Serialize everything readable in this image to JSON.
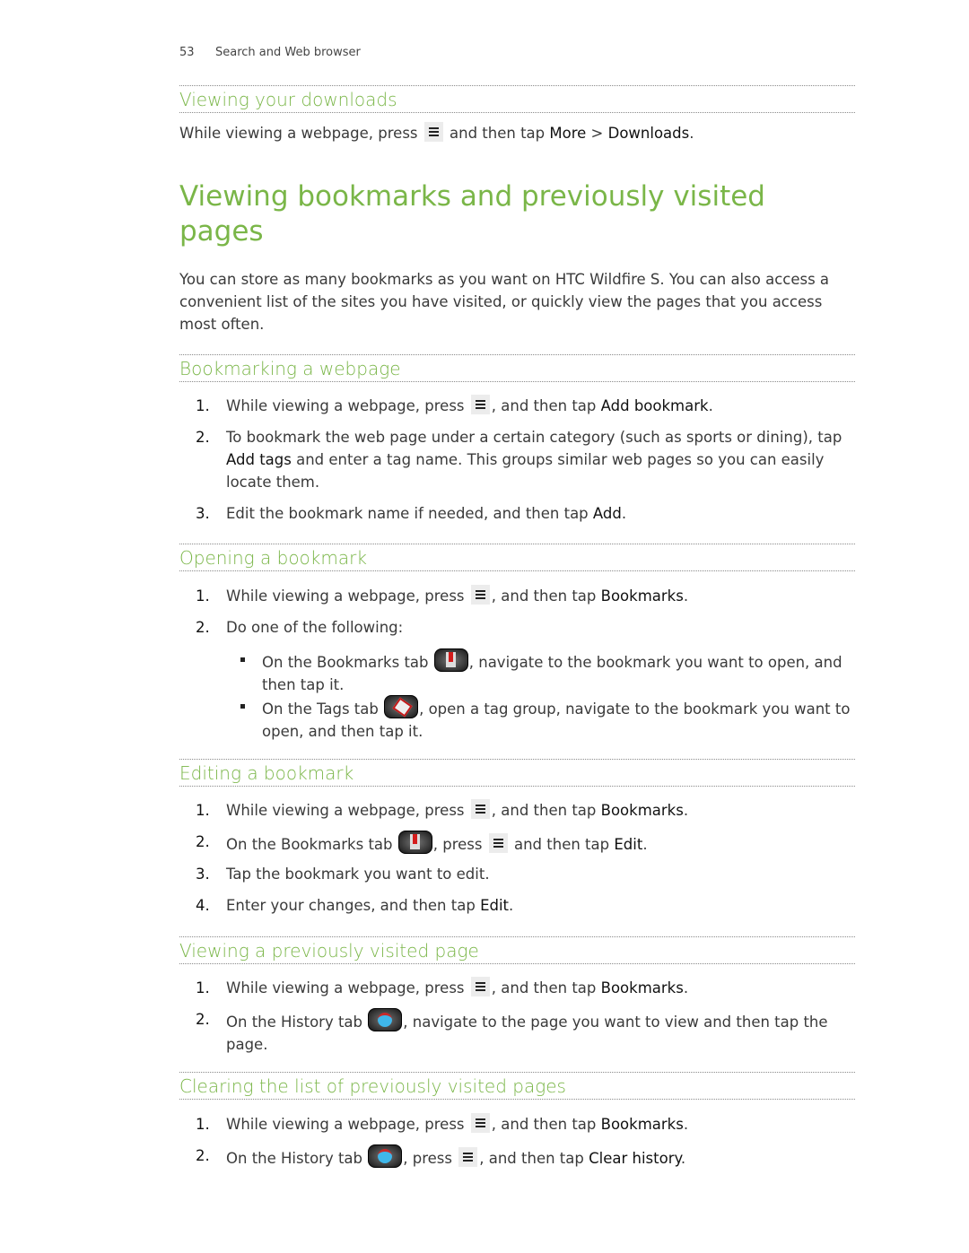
{
  "running_head": {
    "page_number": "53",
    "section": "Search and Web browser"
  },
  "colors": {
    "heading": "#7ab648",
    "body": "#3a3a3a"
  },
  "downloads": {
    "heading": "Viewing your downloads",
    "text_a": "While viewing a webpage, press ",
    "icon": "menu-icon",
    "text_b": " and then tap ",
    "ui_more": "More",
    "sep": " > ",
    "ui_downloads": "Downloads",
    "end": "."
  },
  "main": {
    "title": "Viewing bookmarks and previously visited pages",
    "intro": "You can store as many bookmarks as you want on HTC Wildfire S. You can also access a convenient list of the sites you have visited, or quickly view the pages that you access most often."
  },
  "bookmarking": {
    "heading": "Bookmarking a webpage",
    "steps": [
      {
        "num": "1.",
        "a": "While viewing a webpage, press ",
        "b": ", and then tap ",
        "ui": "Add bookmark",
        "end": "."
      },
      {
        "num": "2.",
        "a": "To bookmark the web page under a certain category (such as sports or dining), tap ",
        "ui": "Add tags",
        "b": " and enter a tag name. This groups similar web pages so you can easily locate them."
      },
      {
        "num": "3.",
        "a": "Edit the bookmark name if needed, and then tap ",
        "ui": "Add",
        "end": "."
      }
    ]
  },
  "opening": {
    "heading": "Opening a bookmark",
    "steps": [
      {
        "num": "1.",
        "a": "While viewing a webpage, press ",
        "b": ", and then tap ",
        "ui": "Bookmarks",
        "end": "."
      },
      {
        "num": "2.",
        "a": "Do one of the following:"
      }
    ],
    "bullets": [
      {
        "a": "On the Bookmarks tab ",
        "icon": "bookmarks-tab-icon",
        "b": ", navigate to the bookmark you want to open, and then tap it."
      },
      {
        "a": "On the Tags tab ",
        "icon": "tags-tab-icon",
        "b": ", open a tag group, navigate to the bookmark you want to open, and then tap it."
      }
    ]
  },
  "editing": {
    "heading": "Editing a bookmark",
    "steps": [
      {
        "num": "1.",
        "a": "While viewing a webpage, press ",
        "b": ", and then tap ",
        "ui": "Bookmarks",
        "end": "."
      },
      {
        "num": "2.",
        "a": "On the Bookmarks tab ",
        "b": ", press ",
        "c": " and then tap ",
        "ui": "Edit",
        "end": "."
      },
      {
        "num": "3.",
        "a": "Tap the bookmark you want to edit."
      },
      {
        "num": "4.",
        "a": "Enter your changes, and then tap ",
        "ui": "Edit",
        "end": "."
      }
    ]
  },
  "visited": {
    "heading": "Viewing a previously visited page",
    "steps": [
      {
        "num": "1.",
        "a": "While viewing a webpage, press ",
        "b": ", and then tap ",
        "ui": "Bookmarks",
        "end": "."
      },
      {
        "num": "2.",
        "a": "On the History tab ",
        "b": ", navigate to the page you want to view and then tap the page."
      }
    ]
  },
  "clearing": {
    "heading": "Clearing the list of previously visited pages",
    "steps": [
      {
        "num": "1.",
        "a": "While viewing a webpage, press ",
        "b": ", and then tap ",
        "ui": "Bookmarks",
        "end": "."
      },
      {
        "num": "2.",
        "a": "On the History tab ",
        "b": ", press ",
        "c": ", and then tap ",
        "ui": "Clear history",
        "end": "."
      }
    ]
  }
}
